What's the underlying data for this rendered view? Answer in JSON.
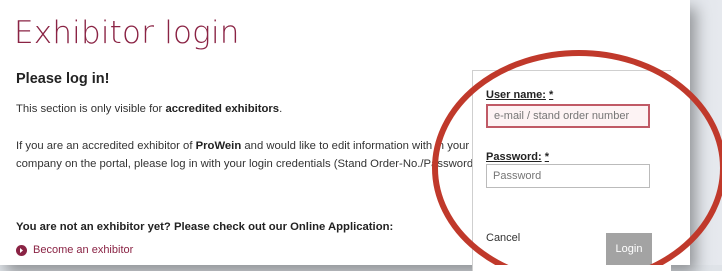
{
  "page_title": "Exhibitor login",
  "subtitle": "Please log in!",
  "intro": {
    "prefix": "This section is only visible for ",
    "bold": "accredited exhibitors",
    "suffix": "."
  },
  "info": {
    "prefix": "If you are an accredited exhibitor of ",
    "bold": "ProWein",
    "suffix": " and would like to edit information with in your company on the portal, please log in with your login credentials (Stand Order-No./Password)."
  },
  "not_exhibitor": "You are not an exhibitor yet? Please check out our Online Application:",
  "become_exhibitor": "Become an exhibitor",
  "form": {
    "username_label": "User name:",
    "password_label": "Password:",
    "required_marker": "*",
    "username_placeholder": "e-mail / stand order number",
    "password_placeholder": "Password",
    "cancel_label": "Cancel",
    "login_label": "Login"
  },
  "colors": {
    "accent": "#8a2344",
    "highlight_circle": "#c0392b",
    "login_button": "#a3a3a3"
  }
}
